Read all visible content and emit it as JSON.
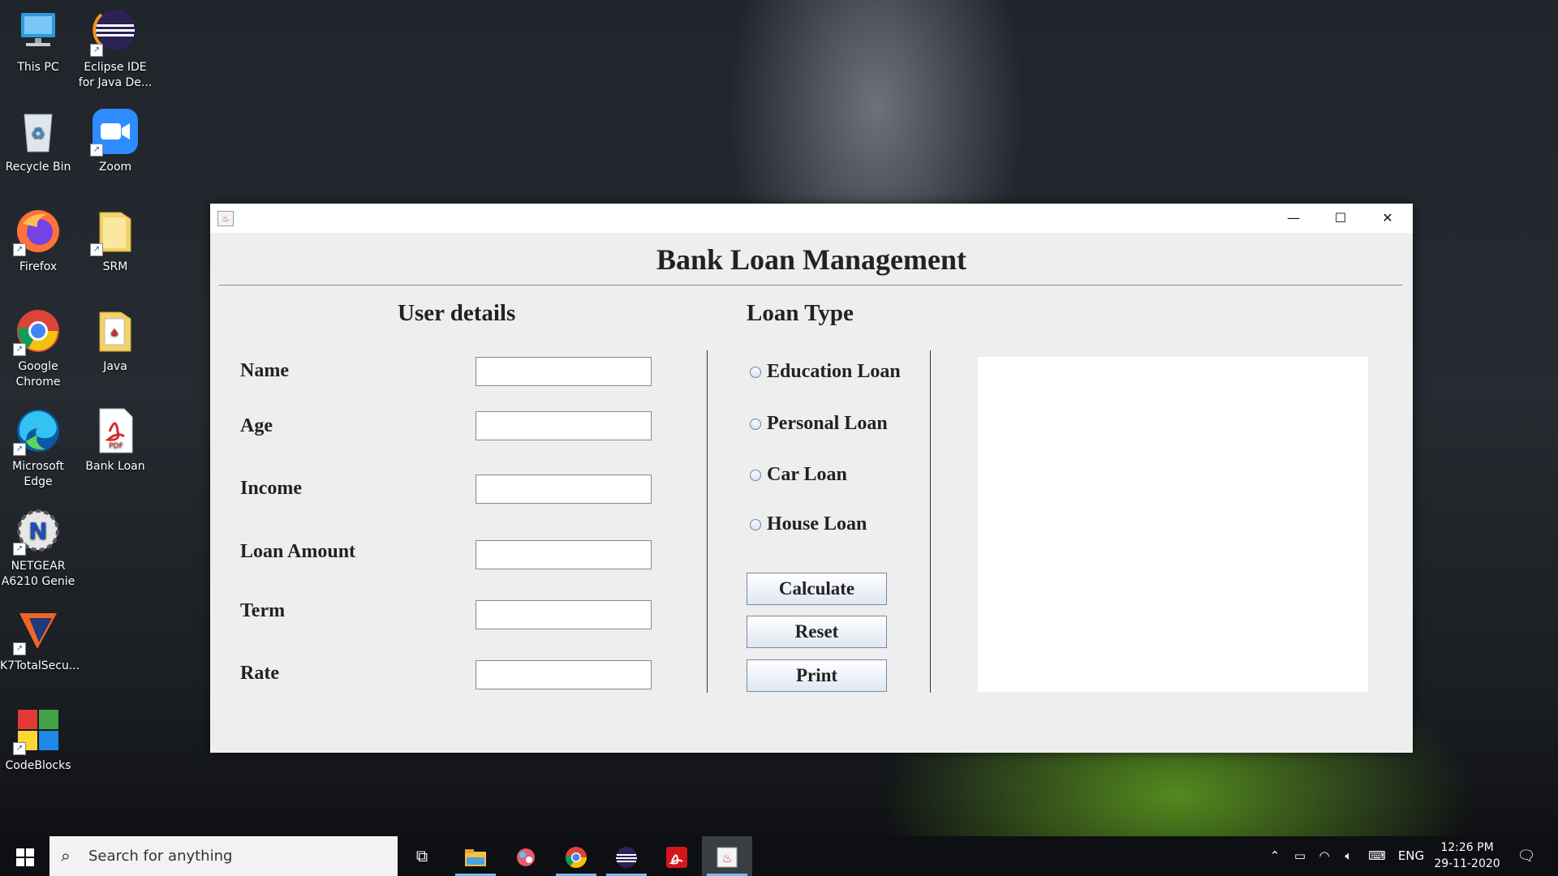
{
  "desktop": {
    "icons": [
      {
        "label": "This PC"
      },
      {
        "label": "Eclipse IDE for Java De..."
      },
      {
        "label": "Recycle Bin"
      },
      {
        "label": "Zoom"
      },
      {
        "label": "Firefox"
      },
      {
        "label": "SRM"
      },
      {
        "label": "Google Chrome"
      },
      {
        "label": "Java"
      },
      {
        "label": "Microsoft Edge"
      },
      {
        "label": "Bank Loan"
      },
      {
        "label": "NETGEAR A6210 Genie"
      },
      {
        "label": "K7TotalSecu..."
      },
      {
        "label": "CodeBlocks"
      }
    ]
  },
  "window": {
    "controls": {
      "minimize": "—",
      "maximize": "☐",
      "close": "✕"
    },
    "title": "Bank Loan Management",
    "user_details": {
      "heading": "User details",
      "fields": [
        {
          "label": "Name",
          "value": ""
        },
        {
          "label": "Age",
          "value": ""
        },
        {
          "label": "Income",
          "value": ""
        },
        {
          "label": "Loan Amount",
          "value": ""
        },
        {
          "label": "Term",
          "value": ""
        },
        {
          "label": "Rate",
          "value": ""
        }
      ]
    },
    "loan_type": {
      "heading": "Loan Type",
      "options": [
        {
          "label": "Education Loan",
          "selected": false
        },
        {
          "label": "Personal Loan",
          "selected": false
        },
        {
          "label": "Car Loan",
          "selected": false
        },
        {
          "label": "House Loan",
          "selected": false
        }
      ]
    },
    "buttons": {
      "calculate": "Calculate",
      "reset": "Reset",
      "print": "Print"
    },
    "output": ""
  },
  "taskbar": {
    "search_placeholder": "Search for anything",
    "tray": {
      "language": "ENG",
      "time": "12:26 PM",
      "date": "29-11-2020"
    }
  },
  "colors": {
    "window_bg": "#eeeeee",
    "accent": "#76b9ed",
    "button_border": "#7a8aa5"
  }
}
